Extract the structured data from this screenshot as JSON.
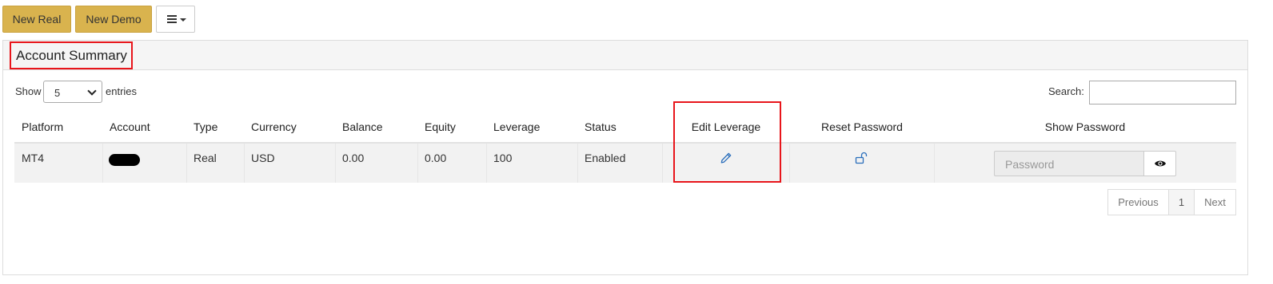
{
  "toolbar": {
    "new_real_label": "New Real",
    "new_demo_label": "New Demo",
    "menu_icon": "hamburger-icon"
  },
  "panel": {
    "title": "Account Summary"
  },
  "table_controls": {
    "show_label": "Show",
    "entries_selected": "5",
    "entries_label": "entries",
    "search_label": "Search:",
    "search_value": ""
  },
  "table": {
    "columns": [
      "Platform",
      "Account",
      "Type",
      "Currency",
      "Balance",
      "Equity",
      "Leverage",
      "Status",
      "Edit Leverage",
      "Reset Password",
      "Show Password"
    ],
    "rows": [
      {
        "platform": "MT4",
        "account": "",
        "type": "Real",
        "currency": "USD",
        "balance": "0.00",
        "equity": "0.00",
        "leverage": "100",
        "status": "Enabled",
        "edit_icon": "pencil-icon",
        "reset_icon": "unlock-icon",
        "password_placeholder": "Password",
        "show_icon": "eye-icon"
      }
    ]
  },
  "pagination": {
    "previous": "Previous",
    "current": "1",
    "next": "Next"
  },
  "colors": {
    "button_gold": "#d9b34e",
    "highlight_red": "#e8151b",
    "icon_blue": "#2a6ebb",
    "row_bg": "#f2f2f2"
  }
}
